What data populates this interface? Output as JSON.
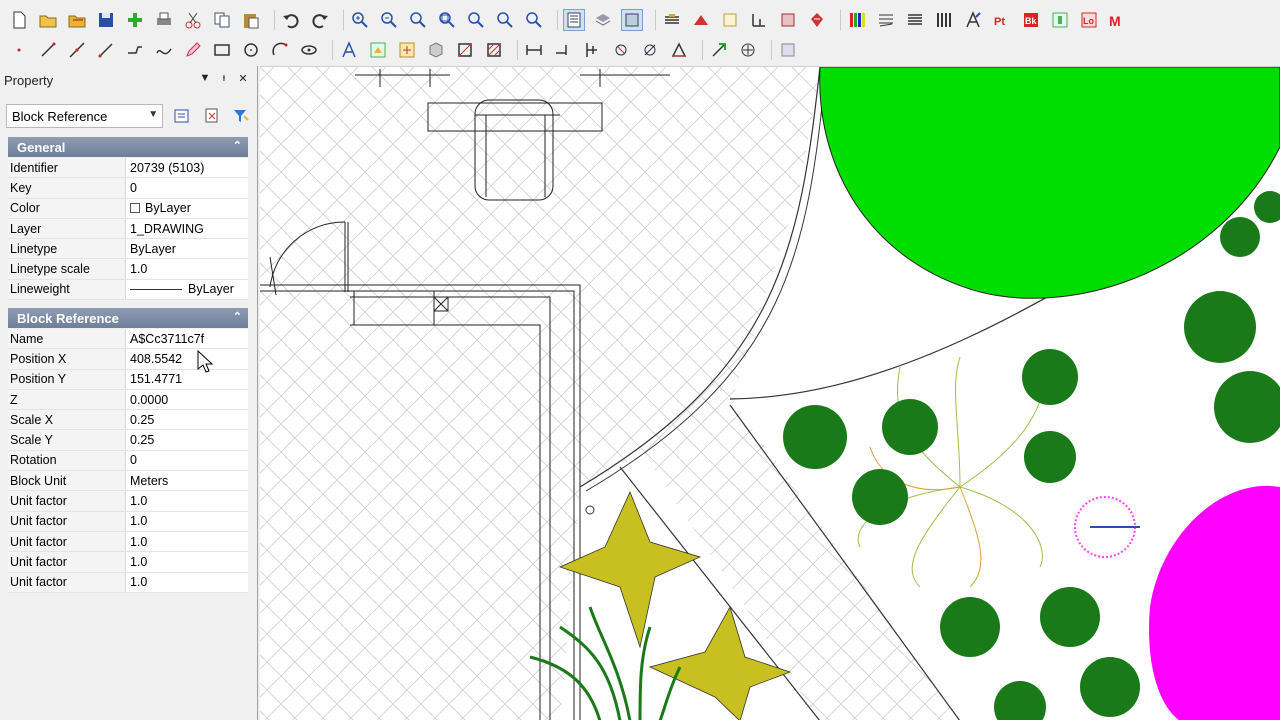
{
  "toolbar_row1": [
    "new-icon",
    "open-icon",
    "open-folder-icon",
    "save-icon",
    "add-icon",
    "print-icon",
    "cut-icon",
    "copy-icon",
    "paste-icon",
    "undo-icon",
    "redo-icon",
    "zoom-in-icon",
    "zoom-out-icon",
    "zoom-window-icon",
    "zoom-extents-icon",
    "zoom-all-icon",
    "zoom-realtime-icon",
    "zoom-previous-icon",
    "properties-icon",
    "layers-icon",
    "view-icon",
    "hatch-icon",
    "block-icon",
    "insert-icon",
    "image-icon",
    "hyperlink-icon",
    "palette-icon",
    "layer-states-icon",
    "lineweight-icon",
    "columns-icon",
    "text-style-icon",
    "point-icon",
    "block-editor-icon",
    "table-icon",
    "layout-icon",
    "multiline-icon"
  ],
  "toolbar_row2": [
    "point-tool-icon",
    "line-icon",
    "xline-icon",
    "ray-icon",
    "polyline-icon",
    "spline-icon",
    "pencil-icon",
    "rectangle-icon",
    "circle-icon",
    "arc-icon",
    "ellipse-icon",
    "text-icon",
    "insert-block-icon",
    "make-block-icon",
    "3d-icon",
    "region-icon",
    "hatch-tool-icon",
    "dimension-icon",
    "move-icon",
    "stretch-icon",
    "rotate-icon",
    "mirror-icon",
    "offset-icon",
    "extend-icon",
    "snap-icon",
    "window-icon"
  ],
  "panel": {
    "title": "Property",
    "pin": "▼",
    "dock": "ᵻ",
    "close": "✕",
    "object_type": "Block Reference"
  },
  "general": {
    "title": "General",
    "rows": [
      {
        "key": "Identifier",
        "value": "20739 (5103)"
      },
      {
        "key": "Key",
        "value": "0"
      },
      {
        "key": "Color",
        "value": "ByLayer"
      },
      {
        "key": "Layer",
        "value": "1_DRAWING"
      },
      {
        "key": "Linetype",
        "value": "ByLayer"
      },
      {
        "key": "Linetype scale",
        "value": "1.0"
      },
      {
        "key": "Lineweight",
        "value": "ByLayer"
      }
    ]
  },
  "block": {
    "title": "Block Reference",
    "rows": [
      {
        "key": "Name",
        "value": "A$Cc3711c7f"
      },
      {
        "key": "Position X",
        "value": "408.5542"
      },
      {
        "key": "Position Y",
        "value": "151.4771"
      },
      {
        "key": "Z",
        "value": "0.0000"
      },
      {
        "key": "Scale X",
        "value": "0.25"
      },
      {
        "key": "Scale Y",
        "value": "0.25"
      },
      {
        "key": "Rotation",
        "value": "0"
      },
      {
        "key": "Block Unit",
        "value": "Meters"
      },
      {
        "key": "Unit factor",
        "value": "1.0"
      },
      {
        "key": "Unit factor",
        "value": "1.0"
      },
      {
        "key": "Unit factor",
        "value": "1.0"
      },
      {
        "key": "Unit factor",
        "value": "1.0"
      },
      {
        "key": "Unit factor",
        "value": "1.0"
      }
    ]
  },
  "colors": {
    "lawn_green": "#00dd00",
    "magenta": "#ff00ff",
    "tree_dark": "#1a7a1a",
    "plant_yellow": "#c8c020",
    "section_header": "#7f8ea7"
  }
}
